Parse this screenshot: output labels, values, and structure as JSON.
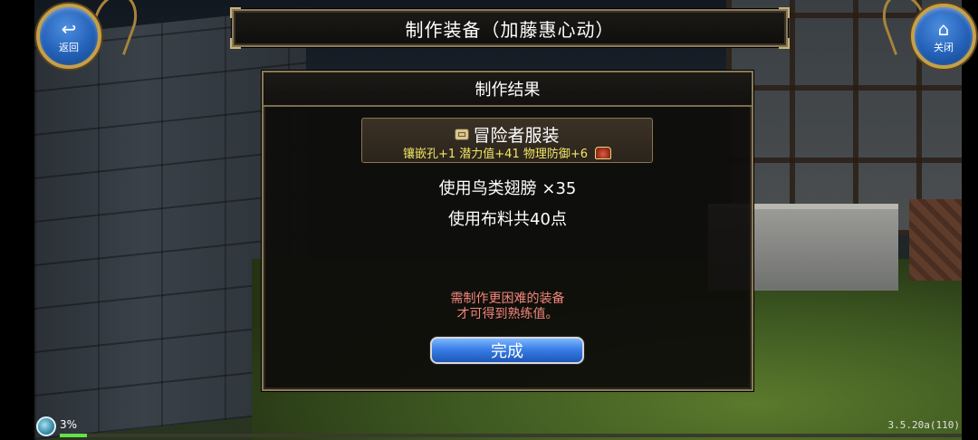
{
  "header": {
    "title": "制作装备（加藤惠心动）",
    "back_label": "返回",
    "close_label": "关闭"
  },
  "dialog": {
    "title": "制作结果",
    "item": {
      "name": "冒险者服装",
      "stats": "镶嵌孔+1  潜力值+41  物理防御+6"
    },
    "materials": [
      "使用鸟类翅膀 ×35",
      "使用布料共40点"
    ],
    "hint_lines": [
      "需制作更困难的装备",
      "才可得到熟练值。"
    ],
    "done_label": "完成"
  },
  "status": {
    "loading_percent": "3%",
    "progress_fraction": 0.03,
    "version": "3.5.20a(110)"
  },
  "colors": {
    "button_blue": "#3a7ee6",
    "frame_gold": "#8a7a58",
    "stat_yellow": "#f2e566",
    "hint_red": "#f2867a"
  },
  "icons": {
    "back": "return-arrow-icon",
    "close": "home-icon",
    "item": "scroll-icon",
    "treasure": "treasure-chest-icon",
    "loading": "loading-orb-icon"
  }
}
